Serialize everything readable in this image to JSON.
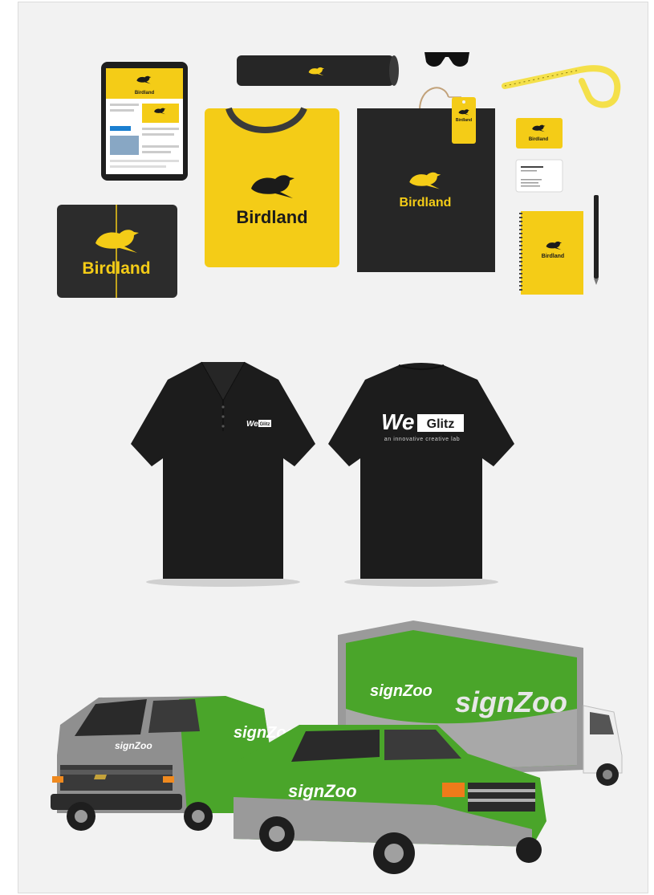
{
  "stationery": {
    "brand_name": "Birdland",
    "accent_color": "#f4cc17",
    "dark_color": "#2b2b2b",
    "items": [
      "tablet",
      "rolled-poster",
      "sunglasses",
      "measuring-tape",
      "folded-tshirt",
      "shopping-bag",
      "hang-tag",
      "business-card-yellow",
      "business-card-white",
      "notebook",
      "pen",
      "folded-shirt-black"
    ]
  },
  "polo": {
    "logo_name": "WeGlitz",
    "logo_we": "We",
    "logo_glitz": "Glitz",
    "tagline": "an innovative creative lab",
    "shirt_color": "#1c1c1c"
  },
  "vehicles": {
    "brand_name": "signZoo",
    "wrap_color": "#4aa52a",
    "items": [
      "van",
      "box-truck",
      "pickup-truck"
    ]
  }
}
